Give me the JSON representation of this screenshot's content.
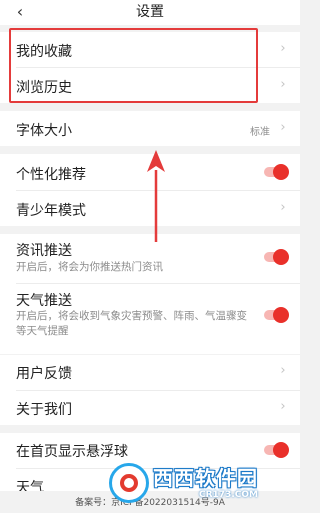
{
  "nav": {
    "back_icon": "chevron-left-icon",
    "title": "设置"
  },
  "group1": {
    "items": [
      {
        "label": "我的收藏"
      },
      {
        "label": "浏览历史"
      }
    ]
  },
  "font_size": {
    "label": "字体大小",
    "value": "标准"
  },
  "group3": {
    "personalized_label": "个性化推荐",
    "personalized_on": true,
    "teen_mode_label": "青少年模式"
  },
  "news_push": {
    "label": "资讯推送",
    "desc": "开启后，将会为你推送热门资讯",
    "on": true
  },
  "weather_push": {
    "label": "天气推送",
    "desc": "开启后，将会收到气象灾害预警、阵雨、气温骤变等天气提醒",
    "on": true
  },
  "group5": {
    "feedback_label": "用户反馈",
    "about_label": "关于我们"
  },
  "group6": {
    "float_ball_label": "在首页显示悬浮球",
    "float_ball_on": true,
    "weather_label": "天气"
  },
  "footer": {
    "icp_text": "备案号：京ICP备2022031514号-9A"
  },
  "watermark": {
    "text": "西西软件园",
    "sub": "CR173.COM"
  },
  "colors": {
    "accent": "#e9302a",
    "highlight": "#e43b3b"
  }
}
